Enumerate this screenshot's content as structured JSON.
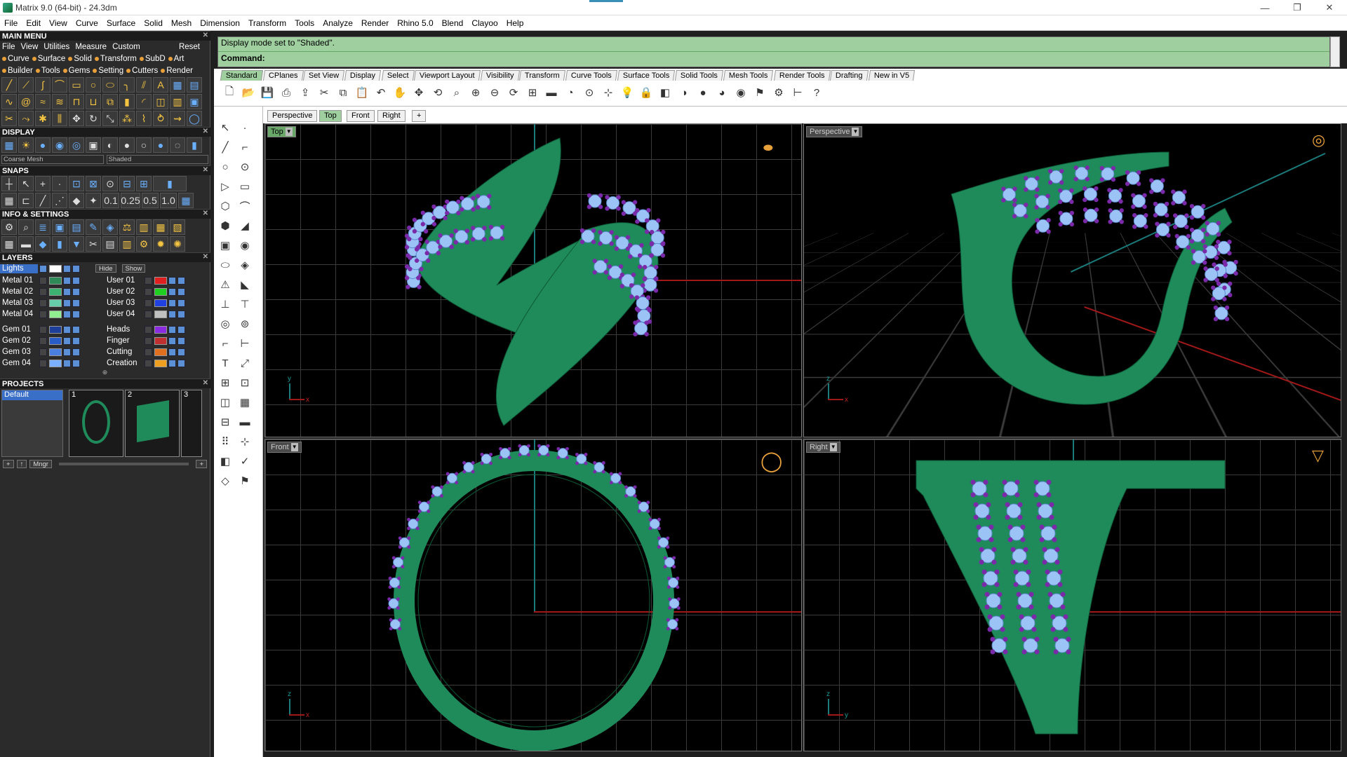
{
  "window": {
    "title": "Matrix 9.0 (64-bit) - 24.3dm",
    "minimize": "—",
    "restore": "❐",
    "close": "✕"
  },
  "menu": [
    "File",
    "Edit",
    "View",
    "Curve",
    "Surface",
    "Solid",
    "Mesh",
    "Dimension",
    "Transform",
    "Tools",
    "Analyze",
    "Render",
    "Rhino 5.0",
    "Blend",
    "Clayoo",
    "Help"
  ],
  "left": {
    "main_menu": {
      "title": "MAIN MENU",
      "row1": [
        "File",
        "View",
        "Utilities",
        "Measure",
        "Custom"
      ],
      "reset": "Reset",
      "row2": [
        "Curve",
        "Surface",
        "Solid",
        "Transform",
        "SubD",
        "Art"
      ],
      "row3": [
        "Builder",
        "Tools",
        "Gems",
        "Setting",
        "Cutters",
        "Render"
      ]
    },
    "display": {
      "title": "DISPLAY",
      "mesh_select": "Coarse Mesh",
      "mode_select": "Shaded"
    },
    "snaps": {
      "title": "SNAPS",
      "values": [
        "0.1",
        "0.25",
        "0.5",
        "1.0"
      ]
    },
    "info": {
      "title": "INFO & SETTINGS"
    },
    "layers": {
      "title": "LAYERS",
      "lights": "Lights",
      "hide": "Hide",
      "show": "Show",
      "left_col": [
        {
          "name": "Metal 01",
          "color": "#2e8b57"
        },
        {
          "name": "Metal 02",
          "color": "#3cb371"
        },
        {
          "name": "Metal 03",
          "color": "#66cdaa"
        },
        {
          "name": "Metal 04",
          "color": "#90ee90"
        },
        {
          "name": "Gem 01",
          "color": "#1e3f99"
        },
        {
          "name": "Gem 02",
          "color": "#2a5cc8"
        },
        {
          "name": "Gem 03",
          "color": "#4a7fe0"
        },
        {
          "name": "Gem 04",
          "color": "#7ab0ff"
        }
      ],
      "right_col": [
        {
          "name": "User 01",
          "color": "#e02020"
        },
        {
          "name": "User 02",
          "color": "#20d020"
        },
        {
          "name": "User 03",
          "color": "#2040e0"
        },
        {
          "name": "User 04",
          "color": "#c0c0c0"
        },
        {
          "name": "Heads",
          "color": "#8a2be2"
        },
        {
          "name": "Finger",
          "color": "#c03030"
        },
        {
          "name": "Cutting",
          "color": "#e07020"
        },
        {
          "name": "Creation",
          "color": "#f0a020"
        }
      ]
    },
    "projects": {
      "title": "PROJECTS",
      "default": "Default",
      "thumbs": [
        "1",
        "2",
        "3"
      ],
      "mngr": "Mngr"
    }
  },
  "command": {
    "history": "Display mode set to \"Shaded\".",
    "prompt": "Command:"
  },
  "toolbar_tabs": [
    "Standard",
    "CPlanes",
    "Set View",
    "Display",
    "Select",
    "Viewport Layout",
    "Visibility",
    "Transform",
    "Curve Tools",
    "Surface Tools",
    "Solid Tools",
    "Mesh Tools",
    "Render Tools",
    "Drafting",
    "New in V5"
  ],
  "viewport_tabs": [
    "Perspective",
    "Top",
    "Front",
    "Right"
  ],
  "viewports": {
    "top": {
      "label": "Top"
    },
    "perspective": {
      "label": "Perspective"
    },
    "front": {
      "label": "Front"
    },
    "right": {
      "label": "Right"
    }
  },
  "colors": {
    "metal": "#1f8a5a",
    "gem": "#9cc3f5",
    "prong": "#7a2aa8"
  }
}
